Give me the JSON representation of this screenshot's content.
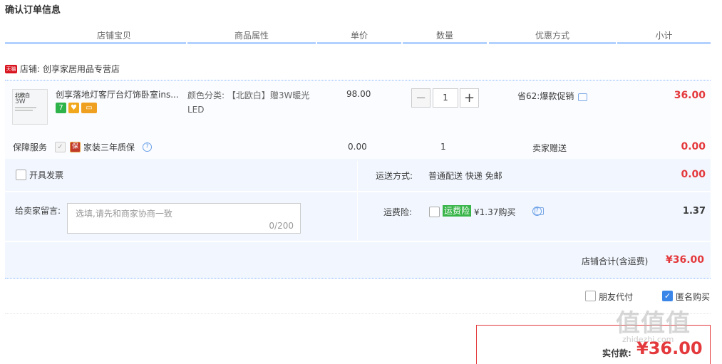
{
  "page": {
    "title": "确认订单信息"
  },
  "columns": [
    "店铺宝贝",
    "商品属性",
    "单价",
    "数量",
    "优惠方式",
    "小计"
  ],
  "shop": {
    "badge": "天猫",
    "label": "店铺:",
    "name": "创享家居用品专营店"
  },
  "item": {
    "thumb_lines": [
      "北欧白",
      "3W"
    ],
    "title": "创享落地灯客厅台灯饰卧室ins...",
    "attr_label": "颜色分类:",
    "attr_value": "【北欧白】赠3W暖光LED",
    "attr_line1": "颜色分类: 【北欧白】赠3W暖光",
    "attr_line2": "LED",
    "price": "98.00",
    "quantity": "1",
    "qty_minus": "−",
    "qty_plus": "+",
    "promo": "省62:爆款促销",
    "subtotal": "36.00",
    "badges": [
      "7",
      "♥",
      "▭"
    ]
  },
  "service": {
    "label": "保障服务",
    "name": "家装三年质保",
    "icon_text": "保",
    "price": "0.00",
    "qty": "1",
    "promo": "卖家赠送",
    "subtotal": "0.00"
  },
  "invoice": {
    "label": "开具发票"
  },
  "delivery": {
    "label": "运送方式:",
    "value": "普通配送 快递 免邮",
    "cost": "0.00"
  },
  "message": {
    "label": "给卖家留言:",
    "placeholder": "选填,请先和商家协商一致",
    "counter": "0/200"
  },
  "insurance": {
    "label": "运费险:",
    "tag": "运费险",
    "text": "¥1.37购买",
    "cost": "1.37"
  },
  "shop_total": {
    "label": "店铺合计(含运费)",
    "value": "¥36.00"
  },
  "options": {
    "friend_pay": "朋友代付",
    "anonymous": "匿名购买"
  },
  "payment": {
    "label": "实付款:",
    "value": "¥36.00"
  },
  "watermark": {
    "main": "值值值",
    "sub": "zhidezhi.com"
  },
  "colors": {
    "accent": "#e4393c",
    "line": "#b2d1ff",
    "panel": "#f2f7ff",
    "check_blue": "#3a86e8",
    "insurance_green": "#39b54a"
  }
}
